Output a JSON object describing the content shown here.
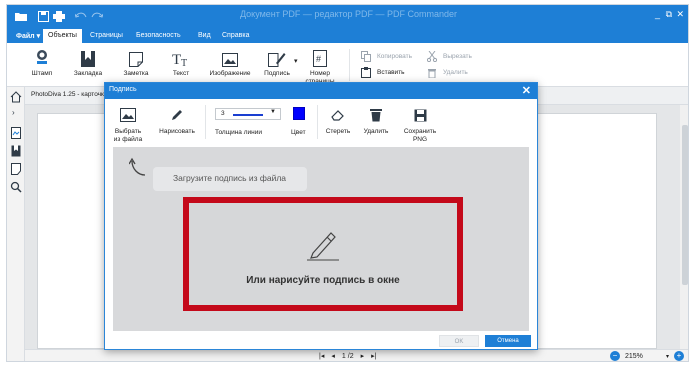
{
  "app": {
    "title": "Документ PDF — редактор PDF — PDF Commander",
    "window_controls": {
      "minimize": "_",
      "restore": "⧉",
      "close": "✕"
    }
  },
  "ribbon": {
    "file_tab": "Файл ▾",
    "tabs": [
      "Объекты",
      "Страницы",
      "Безопасность",
      "Вид",
      "Справка"
    ],
    "active_tab": "Объекты",
    "buttons": {
      "stamp": "Штамп",
      "bookmark": "Закладка",
      "note": "Заметка",
      "text": "Текст",
      "image": "Изображение",
      "signature": "Подпись",
      "page_number": "Номер страницы"
    },
    "clipboard": {
      "copy": "Копировать",
      "paste": "Вставить",
      "cut": "Вырезать",
      "delete": "Удалить"
    }
  },
  "document": {
    "tab_label": "PhotoDiva 1.25 - карточк"
  },
  "status": {
    "page_current": "1",
    "page_total": "/2",
    "zoom": "215%"
  },
  "dialog": {
    "title": "Подпись",
    "close": "✕",
    "toolbar": {
      "load_file": "Выбрать из файла",
      "draw": "Нарисовать",
      "line_thickness_label": "Толщина линии",
      "line_thickness_value": "3",
      "color_label": "Цвет",
      "erase": "Стереть",
      "delete": "Удалить",
      "save_png": "Сохранить PNG"
    },
    "canvas": {
      "upload_hint": "Загрузите подпись из файла",
      "draw_hint": "Или нарисуйте подпись в окне"
    },
    "footer": {
      "ok": "OK",
      "cancel": "Отмена"
    }
  },
  "colors": {
    "accent": "#1e7fd6",
    "signature_color": "#0000ff",
    "highlight_frame": "#c4091a"
  }
}
